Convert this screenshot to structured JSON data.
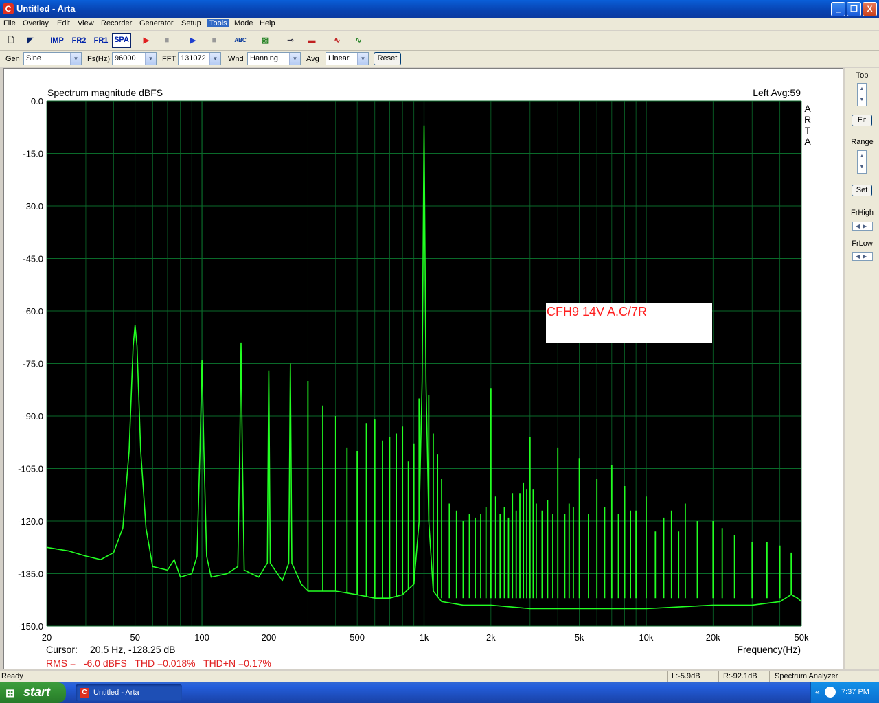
{
  "window": {
    "title": "Untitled - Arta",
    "app_icon": "arta-app-icon",
    "minimize": "_",
    "maximize": "❐",
    "close": "X"
  },
  "menu": [
    "File",
    "Overlay",
    "Edit",
    "View",
    "Recorder",
    "Generator",
    "Setup",
    "Tools",
    "Mode",
    "Help"
  ],
  "menu_active": "Tools",
  "toolbar": {
    "items": [
      "new-icon",
      "open-icon",
      "Imp",
      "Fr2",
      "Fr1",
      "Spa",
      "record-icon",
      "stop-icon",
      "play-icon",
      "stop-icon",
      "abc-icon",
      "chart-icon",
      "probe-icon",
      "spectrum-icon",
      "signal-icon",
      "scope-icon"
    ],
    "imp_label": "IMP",
    "fr2_label": "FR2",
    "fr1_label": "FR1",
    "spa_label": "SPA"
  },
  "params": {
    "gen_label": "Gen",
    "gen_value": "Sine",
    "fs_label": "Fs(Hz)",
    "fs_value": "96000",
    "fft_label": "FFT",
    "fft_value": "131072",
    "wnd_label": "Wnd",
    "wnd_value": "Hanning",
    "avg_label": "Avg",
    "avg_value": "Linear",
    "reset_label": "Reset"
  },
  "sidebar": {
    "top_label": "Top",
    "fit_label": "Fit",
    "range_label": "Range",
    "set_label": "Set",
    "frhigh_label": "FrHigh",
    "frlow_label": "FrLow"
  },
  "readouts": {
    "cursor_label": "Cursor:",
    "cursor_value": "20.5 Hz, -128.25 dB",
    "rms": "RMS =   -6.0 dBFS   THD =0.018%   THD+N =0.17%",
    "channel": "Left  Avg:59",
    "brand": [
      "A",
      "R",
      "T",
      "A"
    ],
    "note": "CFH9 14V A.C/7R"
  },
  "status": {
    "ready": "Ready",
    "left_level": "L:-5.9dB",
    "right_level": "R:-92.1dB",
    "mode": "Spectrum Analyzer"
  },
  "taskbar": {
    "start": "start",
    "task": "Untitled - Arta",
    "clock": "7:37 PM"
  },
  "colors": {
    "plot_bg": "#000000",
    "grid": "#0a6a2a",
    "trace": "#22ff22",
    "annotation": "#ff2020"
  },
  "chart_data": {
    "type": "line",
    "title": "Spectrum magnitude dBFS",
    "xlabel": "Frequency(Hz)",
    "ylabel": "",
    "x_scale": "log",
    "xlim": [
      20,
      50000
    ],
    "ylim": [
      -150,
      0
    ],
    "y_ticks": [
      "0.0",
      "-15.0",
      "-30.0",
      "-45.0",
      "-60.0",
      "-75.0",
      "-90.0",
      "-105.0",
      "-120.0",
      "-135.0",
      "-150.0"
    ],
    "x_ticks": [
      {
        "v": 20,
        "label": "20"
      },
      {
        "v": 50,
        "label": "50"
      },
      {
        "v": 100,
        "label": "100"
      },
      {
        "v": 200,
        "label": "200"
      },
      {
        "v": 500,
        "label": "500"
      },
      {
        "v": 1000,
        "label": "1k"
      },
      {
        "v": 2000,
        "label": "2k"
      },
      {
        "v": 5000,
        "label": "5k"
      },
      {
        "v": 10000,
        "label": "10k"
      },
      {
        "v": 20000,
        "label": "20k"
      },
      {
        "v": 50000,
        "label": "50k"
      }
    ],
    "grid": true,
    "series": [
      {
        "points": [
          [
            20,
            -127.5
          ],
          [
            25,
            -128.5
          ],
          [
            30,
            -130
          ],
          [
            35,
            -131
          ],
          [
            40,
            -129
          ],
          [
            44,
            -122
          ],
          [
            47,
            -100
          ],
          [
            49,
            -70
          ],
          [
            50,
            -64
          ],
          [
            51,
            -70
          ],
          [
            53,
            -100
          ],
          [
            56,
            -122
          ],
          [
            60,
            -133
          ],
          [
            70,
            -134
          ],
          [
            75,
            -131
          ],
          [
            80,
            -136
          ],
          [
            90,
            -135
          ],
          [
            95,
            -130
          ],
          [
            98,
            -100
          ],
          [
            100,
            -74
          ],
          [
            102,
            -100
          ],
          [
            105,
            -130
          ],
          [
            110,
            -136
          ],
          [
            130,
            -135
          ],
          [
            145,
            -133
          ],
          [
            148,
            -100
          ],
          [
            150,
            -69
          ],
          [
            152,
            -100
          ],
          [
            155,
            -134
          ],
          [
            180,
            -136
          ],
          [
            197,
            -132
          ],
          [
            200,
            -77
          ],
          [
            203,
            -132
          ],
          [
            230,
            -137
          ],
          [
            246,
            -132
          ],
          [
            250,
            -75
          ],
          [
            254,
            -132
          ],
          [
            280,
            -138
          ],
          [
            300,
            -140
          ],
          [
            400,
            -140
          ],
          [
            500,
            -141
          ],
          [
            600,
            -142
          ],
          [
            700,
            -142
          ],
          [
            800,
            -141
          ],
          [
            900,
            -138
          ],
          [
            950,
            -120
          ],
          [
            980,
            -80
          ],
          [
            1000,
            -7
          ],
          [
            1020,
            -80
          ],
          [
            1050,
            -120
          ],
          [
            1100,
            -140
          ],
          [
            1200,
            -143
          ],
          [
            1500,
            -144
          ],
          [
            2000,
            -144
          ],
          [
            3000,
            -145
          ],
          [
            5000,
            -145
          ],
          [
            8000,
            -145
          ],
          [
            10000,
            -145
          ],
          [
            20000,
            -144
          ],
          [
            30000,
            -144
          ],
          [
            40000,
            -143
          ],
          [
            45000,
            -141
          ],
          [
            48000,
            -142
          ],
          [
            50000,
            -143
          ]
        ],
        "peaks": [
          [
            150,
            -69
          ],
          [
            200,
            -77
          ],
          [
            250,
            -75
          ],
          [
            300,
            -80
          ],
          [
            350,
            -87
          ],
          [
            400,
            -90
          ],
          [
            450,
            -99
          ],
          [
            500,
            -100
          ],
          [
            550,
            -92
          ],
          [
            600,
            -91
          ],
          [
            650,
            -97
          ],
          [
            700,
            -96
          ],
          [
            750,
            -95
          ],
          [
            800,
            -93
          ],
          [
            850,
            -103
          ],
          [
            900,
            -98
          ],
          [
            950,
            -85
          ],
          [
            1050,
            -84
          ],
          [
            1100,
            -95
          ],
          [
            1150,
            -101
          ],
          [
            1200,
            -108
          ],
          [
            1300,
            -115
          ],
          [
            1400,
            -117
          ],
          [
            1500,
            -120
          ],
          [
            1600,
            -118
          ],
          [
            1700,
            -119
          ],
          [
            1800,
            -118
          ],
          [
            1900,
            -116
          ],
          [
            2000,
            -82
          ],
          [
            2100,
            -113
          ],
          [
            2200,
            -118
          ],
          [
            2300,
            -116
          ],
          [
            2400,
            -119
          ],
          [
            2500,
            -112
          ],
          [
            2600,
            -117
          ],
          [
            2700,
            -112
          ],
          [
            2800,
            -109
          ],
          [
            2900,
            -111
          ],
          [
            3000,
            -96
          ],
          [
            3100,
            -111
          ],
          [
            3200,
            -115
          ],
          [
            3400,
            -117
          ],
          [
            3600,
            -114
          ],
          [
            3800,
            -118
          ],
          [
            4000,
            -99
          ],
          [
            4300,
            -118
          ],
          [
            4500,
            -115
          ],
          [
            4700,
            -116
          ],
          [
            5000,
            -102
          ],
          [
            5500,
            -118
          ],
          [
            6000,
            -108
          ],
          [
            6500,
            -116
          ],
          [
            7000,
            -104
          ],
          [
            7500,
            -118
          ],
          [
            8000,
            -110
          ],
          [
            8500,
            -117
          ],
          [
            9000,
            -117
          ],
          [
            10000,
            -113
          ],
          [
            11000,
            -123
          ],
          [
            12000,
            -119
          ],
          [
            13000,
            -117
          ],
          [
            14000,
            -123
          ],
          [
            15000,
            -115
          ],
          [
            17000,
            -120
          ],
          [
            20000,
            -120
          ],
          [
            22000,
            -122
          ],
          [
            25000,
            -124
          ],
          [
            30000,
            -126
          ],
          [
            35000,
            -126
          ],
          [
            40000,
            -127
          ],
          [
            45000,
            -129
          ]
        ]
      }
    ]
  }
}
